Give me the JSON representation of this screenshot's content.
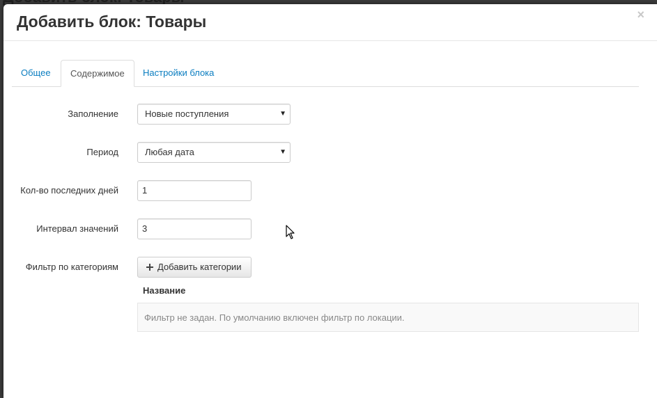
{
  "backdrop": {
    "title": "Добавить блок: Товары"
  },
  "modal": {
    "title": "Добавить блок: Товары",
    "close": "×"
  },
  "tabs": [
    {
      "label": "Общее",
      "active": false
    },
    {
      "label": "Содержимое",
      "active": true
    },
    {
      "label": "Настройки блока",
      "active": false
    }
  ],
  "form": {
    "fill": {
      "label": "Заполнение",
      "value": "Новые поступления"
    },
    "period": {
      "label": "Период",
      "value": "Любая дата"
    },
    "days": {
      "label": "Кол-во последних дней",
      "value": "1"
    },
    "interval": {
      "label": "Интервал значений",
      "value": "3"
    },
    "category_filter": {
      "label": "Фильтр по категориям",
      "button": "Добавить категории",
      "column": "Название",
      "empty": "Фильтр не задан. По умолчанию включен фильтр по локации."
    }
  },
  "icons": {
    "add": "plus-icon",
    "dropdown": "caret-down-icon",
    "close": "close-icon"
  }
}
